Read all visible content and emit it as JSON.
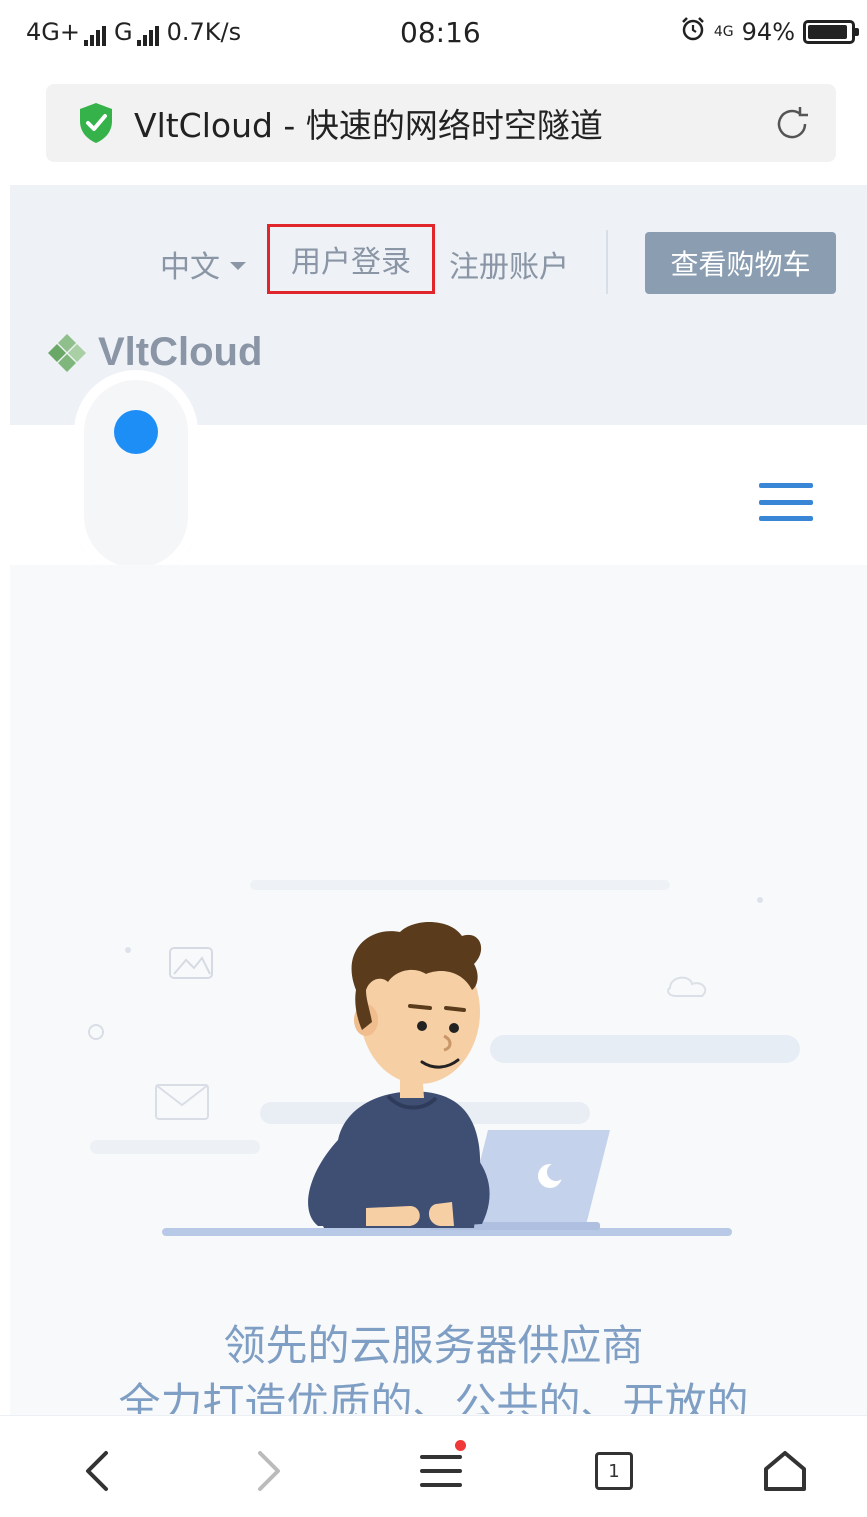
{
  "status_bar": {
    "network1": "4G+",
    "network2": "G",
    "speed": "0.7K/s",
    "time": "08:16",
    "network3": "4G",
    "battery_percent": "94%",
    "battery_level": 0.94
  },
  "url_bar": {
    "page_title": "VltCloud - 快速的网络时空隧道",
    "secure_icon": "green-shield-icon",
    "reload_icon": "reload-icon"
  },
  "site_nav": {
    "language": "中文",
    "login": "用户登录",
    "register": "注册账户",
    "cart_button": "查看购物车"
  },
  "logo": {
    "name": "VltCloud"
  },
  "hero": {
    "slogan_line1": "领先的云服务器供应商",
    "slogan_line2": "全力打造优质的、公共的、开放的"
  },
  "bottom_toolbar": {
    "tab_count": "1"
  },
  "colors": {
    "accent_blue": "#3a86d6",
    "highlight_red": "#e1262b",
    "cart_button": "#8a9db1",
    "widget_dot": "#1e8ef7",
    "secure_green": "#35b34a"
  }
}
